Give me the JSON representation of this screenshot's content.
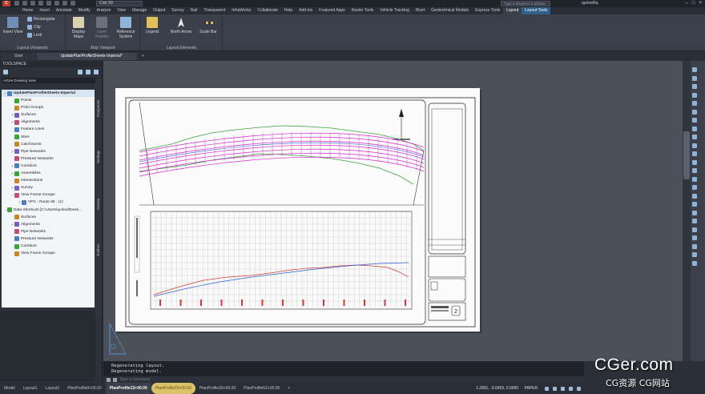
{
  "titlebar": {
    "logo": "C",
    "workspace": "Civil 3D",
    "search_placeholder": "Type a keyword or phrase",
    "user": "quinnd6q",
    "minimize": "–",
    "maximize": "□",
    "close": "×"
  },
  "tabs": [
    "Home",
    "Insert",
    "Annotate",
    "Modify",
    "Analyze",
    "View",
    "Manage",
    "Output",
    "Survey",
    "Rail",
    "Transparent",
    "InfraWorks",
    "Collaborate",
    "Help",
    "Add-ins",
    "Featured Apps",
    "Raster Tools",
    "Vehicle Tracking",
    "Rivet",
    "Geotechnical Module",
    "Express Tools",
    "Layout",
    "Layout Tools"
  ],
  "ribbon": {
    "insert_view": "Insert View",
    "rectangular": "Rectangular",
    "clip": "Clip",
    "lock": "Lock",
    "group_layout_viewports": "Layout Viewports",
    "display_maps": "Display Maps",
    "layer_visibility": "Layer Visibility",
    "reference_system": "Reference System",
    "group_map_viewport": "Map Viewport",
    "legend": "Legend",
    "north_arrow": "North Arrow",
    "scale_bar": "Scale Bar",
    "group_layout_elements": "Layout Elements"
  },
  "doctabs": {
    "start": "Start",
    "drawing": "UpdatePlanProfileSheets-Imperial*",
    "plus": "+"
  },
  "toolspace": {
    "title": "TOOLSPACE",
    "view_selector": "Active Drawing View",
    "vertical_tabs": [
      "Prospector",
      "Settings",
      "Survey",
      "Toolbox"
    ],
    "tree": [
      {
        "label": "UpdatePlanProfileSheets-Imperial",
        "toggle": "−",
        "level": 0
      },
      {
        "label": "Points",
        "toggle": "",
        "level": 1
      },
      {
        "label": "Point Groups",
        "toggle": "",
        "level": 1
      },
      {
        "label": "Surfaces",
        "toggle": "+",
        "level": 1
      },
      {
        "label": "Alignments",
        "toggle": "+",
        "level": 1
      },
      {
        "label": "Feature Lines",
        "toggle": "",
        "level": 1
      },
      {
        "label": "Sites",
        "toggle": "",
        "level": 1
      },
      {
        "label": "Catchments",
        "toggle": "",
        "level": 1
      },
      {
        "label": "Pipe Networks",
        "toggle": "+",
        "level": 1
      },
      {
        "label": "Pressure Networks",
        "toggle": "",
        "level": 1
      },
      {
        "label": "Corridors",
        "toggle": "+",
        "level": 1
      },
      {
        "label": "Assemblies",
        "toggle": "+",
        "level": 1
      },
      {
        "label": "Intersections",
        "toggle": "",
        "level": 1
      },
      {
        "label": "Survey",
        "toggle": "+",
        "level": 1
      },
      {
        "label": "View Frame Groups",
        "toggle": "−",
        "level": 1
      },
      {
        "label": "VFG - Route 66 - (1)",
        "toggle": "+",
        "level": 2
      },
      {
        "label": "Data Shortcuts [C:\\Users\\quinnd\\Desk...",
        "toggle": "−",
        "level": 0
      },
      {
        "label": "Surfaces",
        "toggle": "",
        "level": 1
      },
      {
        "label": "Alignments",
        "toggle": "+",
        "level": 1
      },
      {
        "label": "Pipe Networks",
        "toggle": "",
        "level": 1
      },
      {
        "label": "Pressure Networks",
        "toggle": "",
        "level": 1
      },
      {
        "label": "Corridors",
        "toggle": "",
        "level": 1
      },
      {
        "label": "View Frame Groups",
        "toggle": "",
        "level": 1
      }
    ]
  },
  "command": {
    "history": [
      "Regenerating layout.",
      "Regenerating model."
    ],
    "placeholder": "Type a command"
  },
  "status": {
    "layout_tabs": [
      "Model",
      "Layout1",
      "Layout2",
      "PlanProfile0+00.00",
      "PlanProfile13+00.00",
      "PlanProfile26+00.00",
      "PlanProfile39+00.00",
      "PlanProfile52+00.00"
    ],
    "active_tab": "PlanProfile13+00.00",
    "highlighted_tab": "PlanProfile26+00.00",
    "plus": "+",
    "coordinates": "1.2891, -3.0459, 0.0000",
    "mode": "PAPER"
  },
  "watermark": {
    "primary": "CGer.com",
    "secondary": "CG资源 CG网站"
  },
  "colors": {
    "accent": "#2f5f8a",
    "alignment_magenta": "#d12bd1",
    "terrain_green": "#3aa33a",
    "profile_blue": "#2f5fd1",
    "profile_red": "#d13a3a"
  }
}
